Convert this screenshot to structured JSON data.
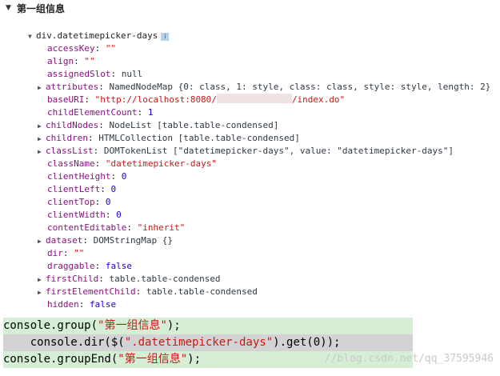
{
  "group_title": "第一组信息",
  "node": "div.datetimepicker-days",
  "info_badge": "i",
  "props": [
    {
      "key": "accessKey",
      "value": "\"\"",
      "kind": "s",
      "expandable": false
    },
    {
      "key": "align",
      "value": "\"\"",
      "kind": "s",
      "expandable": false
    },
    {
      "key": "assignedSlot",
      "value": "null",
      "kind": "o",
      "expandable": false
    },
    {
      "key": "attributes",
      "value": "NamedNodeMap {0: class, 1: style, class: class, style: style, length: 2}",
      "kind": "o",
      "expandable": true
    },
    {
      "key": "baseURI",
      "value_pre": "\"http://localhost:8080/",
      "value_post": "/index.do\"",
      "kind": "s",
      "expandable": false,
      "redacted": true
    },
    {
      "key": "childElementCount",
      "value": "1",
      "kind": "n",
      "expandable": false
    },
    {
      "key": "childNodes",
      "value": "NodeList [table.table-condensed]",
      "kind": "o",
      "expandable": true
    },
    {
      "key": "children",
      "value": "HTMLCollection [table.table-condensed]",
      "kind": "o",
      "expandable": true
    },
    {
      "key": "classList",
      "value": "DOMTokenList [\"datetimepicker-days\", value: \"datetimepicker-days\"]",
      "kind": "o",
      "expandable": true
    },
    {
      "key": "className",
      "value": "\"datetimepicker-days\"",
      "kind": "s",
      "expandable": false
    },
    {
      "key": "clientHeight",
      "value": "0",
      "kind": "n",
      "expandable": false
    },
    {
      "key": "clientLeft",
      "value": "0",
      "kind": "n",
      "expandable": false
    },
    {
      "key": "clientTop",
      "value": "0",
      "kind": "n",
      "expandable": false
    },
    {
      "key": "clientWidth",
      "value": "0",
      "kind": "n",
      "expandable": false
    },
    {
      "key": "contentEditable",
      "value": "\"inherit\"",
      "kind": "s",
      "expandable": false
    },
    {
      "key": "dataset",
      "value": "DOMStringMap {}",
      "kind": "o",
      "expandable": true
    },
    {
      "key": "dir",
      "value": "\"\"",
      "kind": "s",
      "expandable": false
    },
    {
      "key": "draggable",
      "value": "false",
      "kind": "n",
      "expandable": false
    },
    {
      "key": "firstChild",
      "value": "table.table-condensed",
      "kind": "o",
      "expandable": true
    },
    {
      "key": "firstElementChild",
      "value": "table.table-condensed",
      "kind": "o",
      "expandable": true
    },
    {
      "key": "hidden",
      "value": "false",
      "kind": "n",
      "expandable": false
    }
  ],
  "code_lines": [
    {
      "pre": "console.group(",
      "str": "\"第一组信息\"",
      "post": ");"
    },
    {
      "pre": "    console.dir($(",
      "str": "\".datetimepicker-days\"",
      "post": ").get(0));"
    },
    {
      "pre": "console.groupEnd(",
      "str": "\"第一组信息\"",
      "post": ");"
    }
  ],
  "watermark": "//blog.csdn.net/qq_37595946"
}
